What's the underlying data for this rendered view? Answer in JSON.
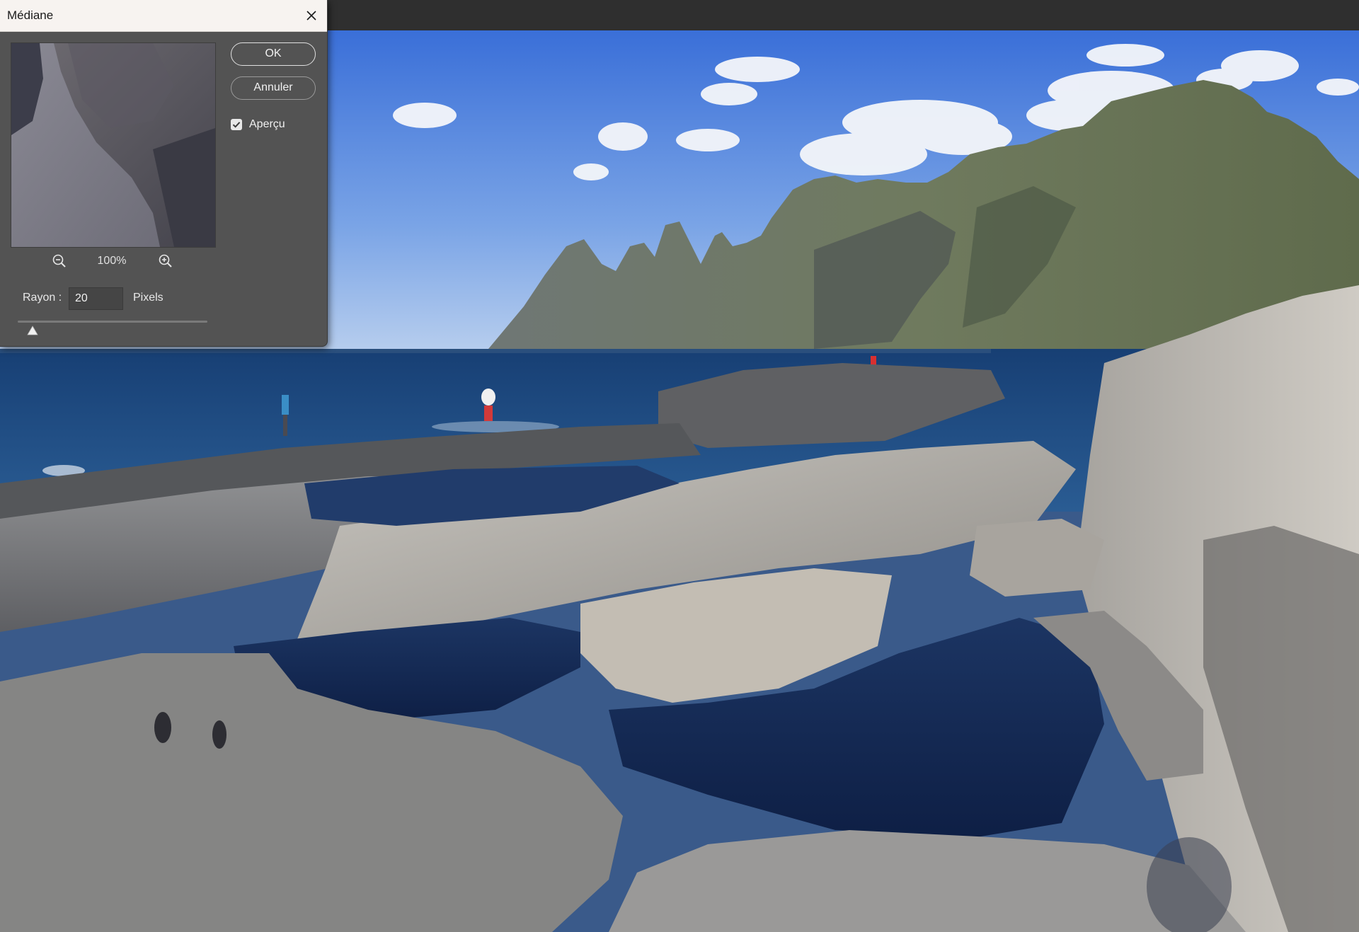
{
  "dialog": {
    "title": "Médiane",
    "ok_label": "OK",
    "cancel_label": "Annuler",
    "preview_label": "Aperçu",
    "preview_checked": true,
    "zoom_level": "100%",
    "radius": {
      "label": "Rayon :",
      "value": "20",
      "unit": "Pixels",
      "slider_fraction": 0.08
    }
  },
  "icons": {
    "close": "close-icon",
    "zoom_out": "zoom-out-icon",
    "zoom_in": "zoom-in-icon",
    "checkbox": "checkmark-icon",
    "slider": "slider-thumb-triangle"
  },
  "colors": {
    "dialog_bg": "#535353",
    "titlebar_bg": "#f7f3f0",
    "app_bg": "#2f2f2f"
  }
}
